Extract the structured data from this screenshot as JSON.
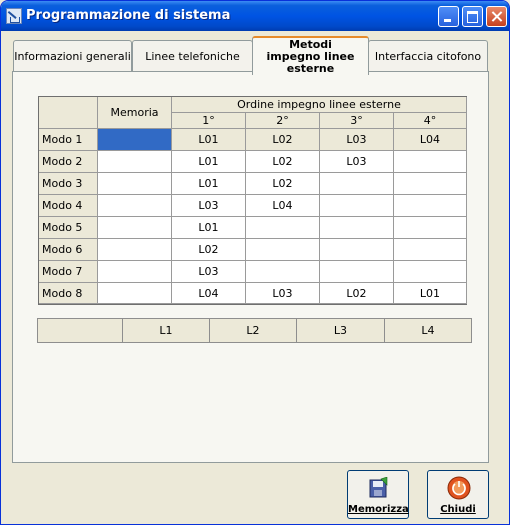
{
  "window": {
    "title": "Programmazione di sistema"
  },
  "tabs": [
    {
      "label": "Informazioni generali"
    },
    {
      "label": "Linee telefoniche"
    },
    {
      "label": "Metodi impegno linee esterne"
    },
    {
      "label": "Interfaccia citofono"
    }
  ],
  "grid": {
    "header_memoria": "Memoria",
    "header_group": "Ordine impegno linee esterne",
    "order_columns": [
      "1°",
      "2°",
      "3°",
      "4°"
    ],
    "rows": [
      {
        "label": "Modo 1",
        "memoria": "",
        "values": [
          "L01",
          "L02",
          "L03",
          "L04"
        ]
      },
      {
        "label": "Modo 2",
        "memoria": "",
        "values": [
          "L01",
          "L02",
          "L03",
          ""
        ]
      },
      {
        "label": "Modo 3",
        "memoria": "",
        "values": [
          "L01",
          "L02",
          "",
          ""
        ]
      },
      {
        "label": "Modo 4",
        "memoria": "",
        "values": [
          "L03",
          "L04",
          "",
          ""
        ]
      },
      {
        "label": "Modo 5",
        "memoria": "",
        "values": [
          "L01",
          "",
          "",
          ""
        ]
      },
      {
        "label": "Modo 6",
        "memoria": "",
        "values": [
          "L02",
          "",
          "",
          ""
        ]
      },
      {
        "label": "Modo 7",
        "memoria": "",
        "values": [
          "L03",
          "",
          "",
          ""
        ]
      },
      {
        "label": "Modo 8",
        "memoria": "",
        "values": [
          "L04",
          "L03",
          "L02",
          "L01"
        ]
      }
    ]
  },
  "line_bar": {
    "blank": "",
    "items": [
      "L1",
      "L2",
      "L3",
      "L4"
    ]
  },
  "buttons": {
    "save_label": "Memorizza",
    "save_icon": "floppy-disk-icon",
    "close_label": "Chiudi",
    "close_icon": "power-icon"
  },
  "colors": {
    "selection": "#316ac5",
    "active_tab_accent": "#e68b2c",
    "title_bar": "#0054e3"
  }
}
